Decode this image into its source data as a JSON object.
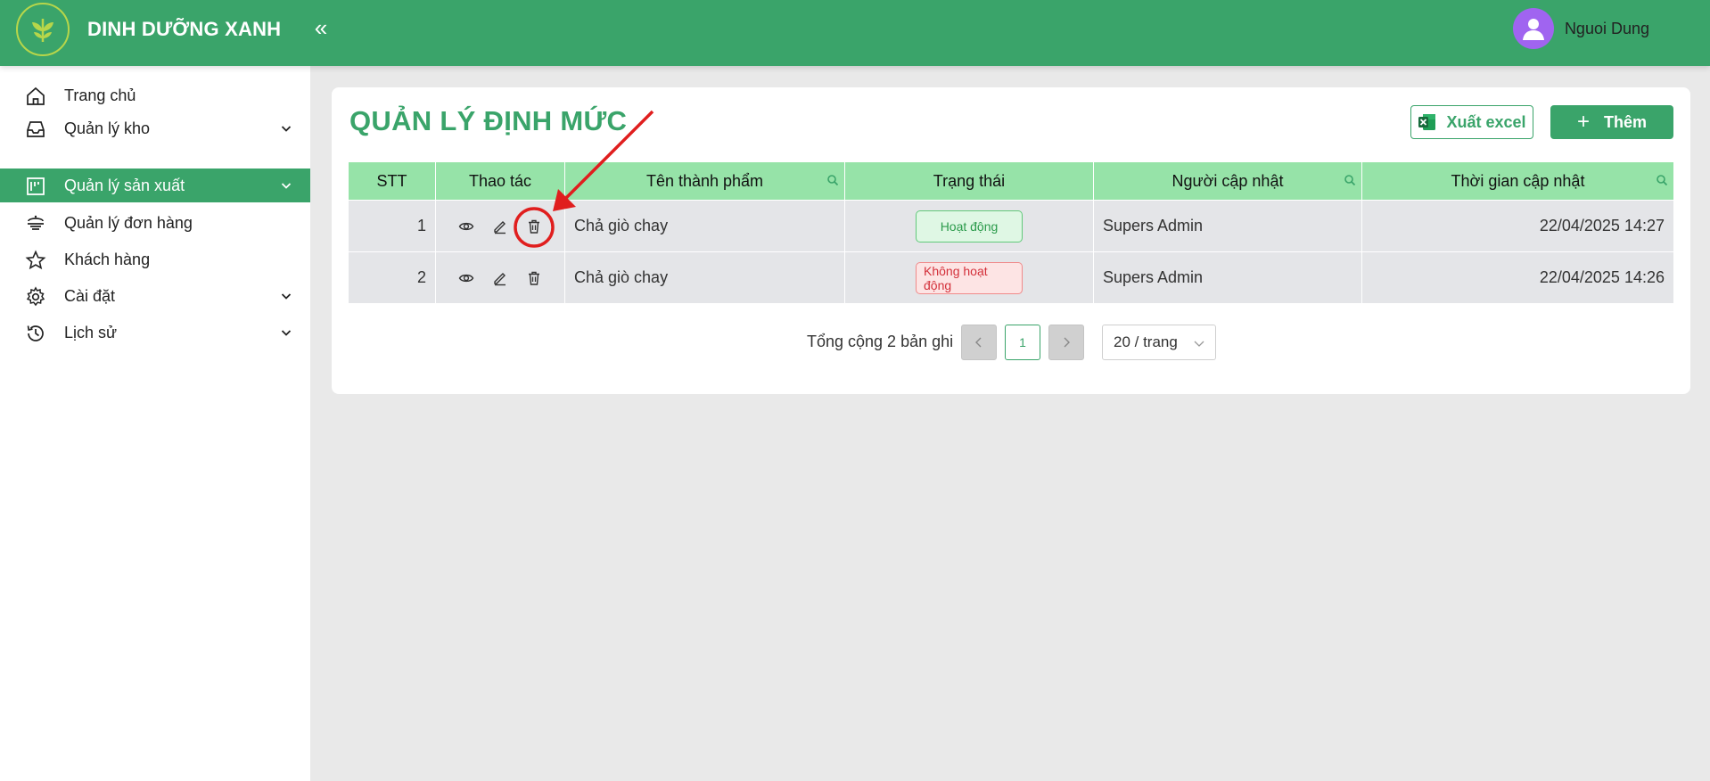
{
  "header": {
    "brand": "DINH DƯỠNG XANH",
    "user_name": "Nguoi Dung"
  },
  "sidebar": {
    "items": [
      {
        "label": "Trang chủ",
        "icon": "home-icon"
      },
      {
        "label": "Quản lý kho",
        "icon": "inbox-icon"
      },
      {
        "label": "Quản lý sản xuất",
        "icon": "factory-icon",
        "active": true
      },
      {
        "label": "Quản lý đơn hàng",
        "icon": "order-icon"
      },
      {
        "label": "Khách hàng",
        "icon": "star-icon"
      },
      {
        "label": "Cài đặt",
        "icon": "gear-icon"
      },
      {
        "label": "Lịch sử",
        "icon": "history-icon"
      }
    ]
  },
  "page": {
    "title": "QUẢN LÝ ĐỊNH MỨC",
    "export_label": "Xuất excel",
    "add_label": "Thêm"
  },
  "table": {
    "columns": [
      "STT",
      "Thao tác",
      "Tên thành phẩm",
      "Trạng thái",
      "Người cập nhật",
      "Thời gian cập nhật"
    ],
    "rows": [
      {
        "stt": "1",
        "name": "Chả giò chay",
        "status": "Hoạt động",
        "status_type": "active",
        "updated_by": "Supers Admin",
        "updated_at": "22/04/2025 14:27"
      },
      {
        "stt": "2",
        "name": "Chả giò chay",
        "status": "Không hoạt động",
        "status_type": "inactive",
        "updated_by": "Supers Admin",
        "updated_at": "22/04/2025 14:26"
      }
    ]
  },
  "pagination": {
    "total": "Tổng cộng 2 bản ghi",
    "current_page": "1",
    "page_size": "20 / trang"
  },
  "colors": {
    "primary": "#3aa46a",
    "table_header": "#96e3a8",
    "annotation": "#e01e1e"
  }
}
